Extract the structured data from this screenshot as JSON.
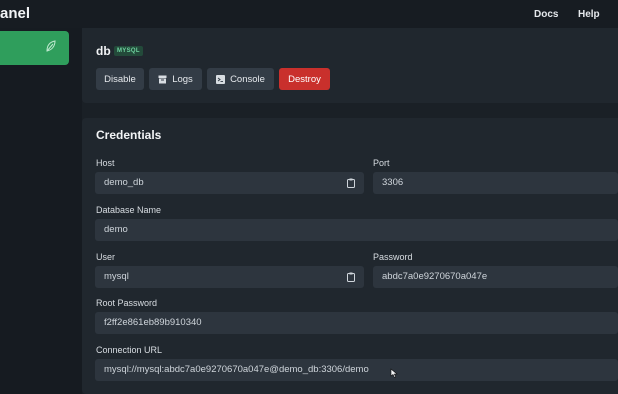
{
  "header": {
    "brand": "anel",
    "nav": [
      {
        "label": "Docs"
      },
      {
        "label": "Help"
      }
    ]
  },
  "sidebar": {
    "active_icon": "leaf-icon",
    "accent": "#2f9e5c"
  },
  "service": {
    "name": "db",
    "badge": "MYSQL",
    "actions": {
      "disable": "Disable",
      "logs": "Logs",
      "console": "Console",
      "destroy": "Destroy"
    }
  },
  "credentials": {
    "title": "Credentials",
    "host": {
      "label": "Host",
      "value": "demo_db"
    },
    "port": {
      "label": "Port",
      "value": "3306"
    },
    "database": {
      "label": "Database Name",
      "value": "demo"
    },
    "user": {
      "label": "User",
      "value": "mysql"
    },
    "password": {
      "label": "Password",
      "value": "abdc7a0e9270670a047e"
    },
    "root_password": {
      "label": "Root Password",
      "value": "f2ff2e861eb89b910340"
    },
    "connection_url": {
      "label": "Connection URL",
      "value": "mysql://mysql:abdc7a0e9270670a047e@demo_db:3306/demo"
    }
  },
  "colors": {
    "danger": "#c9302c",
    "badge_bg": "#234a3a",
    "badge_fg": "#6fd3a0"
  }
}
